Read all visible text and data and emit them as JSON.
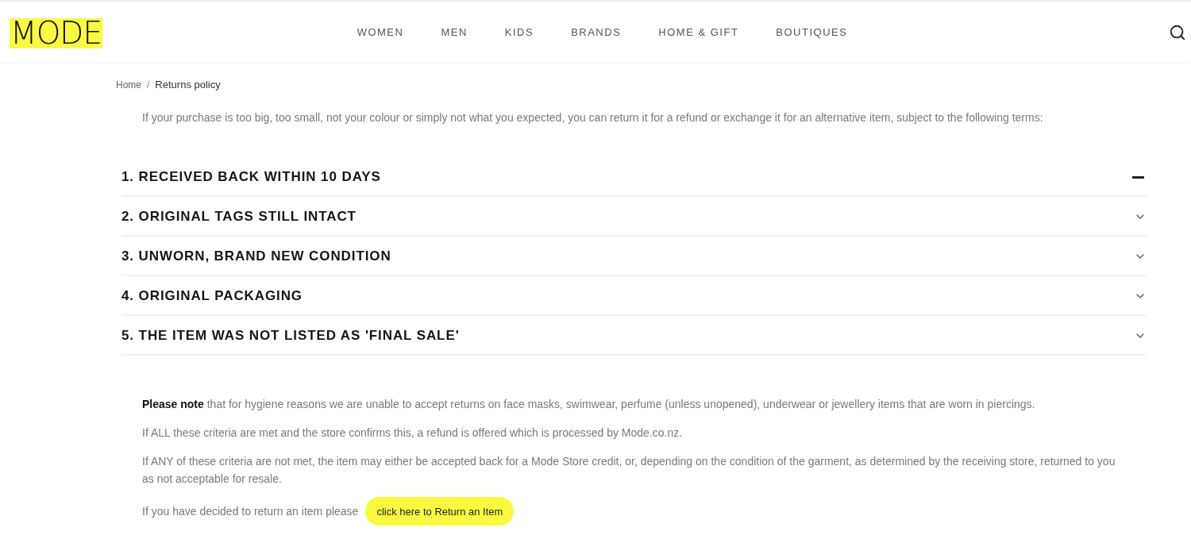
{
  "header": {
    "logo": "MODE",
    "nav": [
      {
        "label": "WOMEN"
      },
      {
        "label": "MEN"
      },
      {
        "label": "KIDS"
      },
      {
        "label": "BRANDS"
      },
      {
        "label": "HOME & GIFT"
      },
      {
        "label": "BOUTIQUES"
      }
    ]
  },
  "breadcrumb": {
    "items": [
      {
        "label": "Home"
      },
      {
        "label": "Returns policy"
      }
    ],
    "separator": "/"
  },
  "intro": "If your purchase is too big, too small, not your colour or simply not what you expected, you can return it for a refund or exchange it for an alternative item, subject to the following terms:",
  "terms": [
    {
      "title": "1. RECEIVED BACK WITHIN 10 DAYS",
      "expanded": true
    },
    {
      "title": "2. ORIGINAL TAGS STILL INTACT",
      "expanded": false
    },
    {
      "title": "3. UNWORN, BRAND NEW CONDITION",
      "expanded": false
    },
    {
      "title": "4. ORIGINAL PACKAGING",
      "expanded": false
    },
    {
      "title": "5. THE ITEM WAS NOT LISTED AS 'FINAL SALE'",
      "expanded": false
    }
  ],
  "notes": [
    "**Please note** that for hygiene reasons we are unable to accept returns on face masks, swimwear, perfume (unless unopened), underwear or jewellery items that are worn in piercings.",
    "If ALL these criteria are met and the store confirms this, a refund is offered which is processed by Mode.co.nz.",
    "If ANY of these criteria are not met, the item may either be accepted back for a Mode Store credit, or, depending on the condition of the garment, as determined by the receiving store, returned to you as not acceptable for resale."
  ],
  "return_prompt": {
    "text": "If you have decided to return an item please",
    "button": "click here to Return an Item"
  }
}
